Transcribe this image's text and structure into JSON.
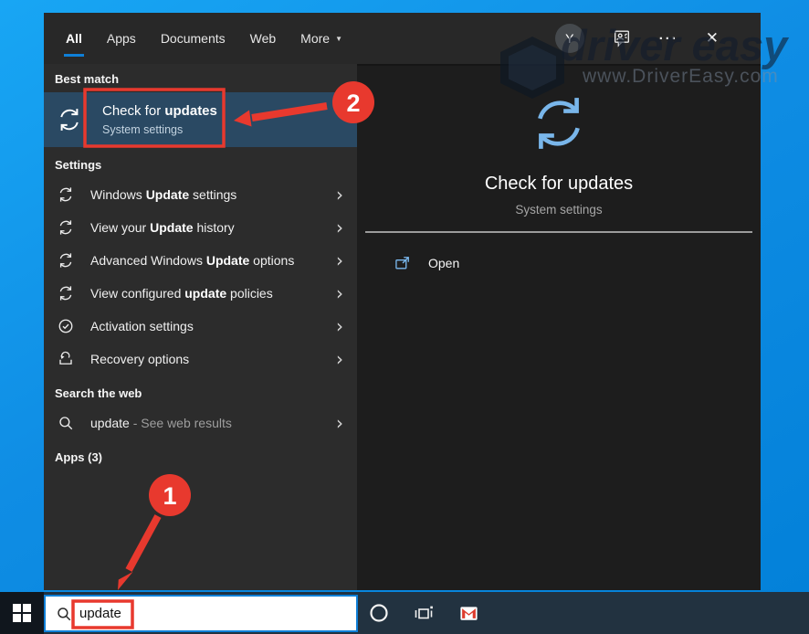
{
  "chrome": {
    "tabs": [
      {
        "label": "All",
        "active": true
      },
      {
        "label": "Apps",
        "active": false
      },
      {
        "label": "Documents",
        "active": false
      },
      {
        "label": "Web",
        "active": false
      },
      {
        "label": "More",
        "active": false,
        "dropdown": true
      }
    ],
    "caret": "▼",
    "avatar_initial": "Y",
    "more_dots": "···",
    "close_glyph": "✕"
  },
  "watermark": {
    "brand": "driver easy",
    "url": "www.DriverEasy.com"
  },
  "left": {
    "best_match_header": "Best match",
    "best_match": {
      "icon": "refresh",
      "pre": "Check for ",
      "bold": "updates",
      "post": "",
      "subtitle": "System settings"
    },
    "sections": [
      {
        "header": "Settings",
        "items": [
          {
            "icon": "refresh",
            "pre": "Windows ",
            "bold": "Update",
            "post": " settings"
          },
          {
            "icon": "refresh",
            "pre": "View your ",
            "bold": "Update",
            "post": " history"
          },
          {
            "icon": "refresh",
            "pre": "Advanced Windows ",
            "bold": "Update",
            "post": " options"
          },
          {
            "icon": "refresh",
            "pre": "View configured ",
            "bold": "update",
            "post": " policies"
          },
          {
            "icon": "check",
            "pre": "Activation settings",
            "bold": "",
            "post": ""
          },
          {
            "icon": "recovery",
            "pre": "Recovery options",
            "bold": "",
            "post": ""
          }
        ]
      },
      {
        "header": "Search the web",
        "items": [
          {
            "icon": "search",
            "query": "update",
            "suffix": " - See web results"
          }
        ]
      }
    ],
    "apps_header": "Apps (3)"
  },
  "right": {
    "title": "Check for updates",
    "subtitle": "System settings",
    "open_label": "Open"
  },
  "taskbar": {
    "search_value": "update"
  },
  "annotations": {
    "step1": "1",
    "step2": "2"
  },
  "colors": {
    "annotation_red": "#e8392e",
    "accent_blue": "#0f7fd7",
    "highlight_row": "#2a4963",
    "refresh_blue": "#79b6ea"
  }
}
